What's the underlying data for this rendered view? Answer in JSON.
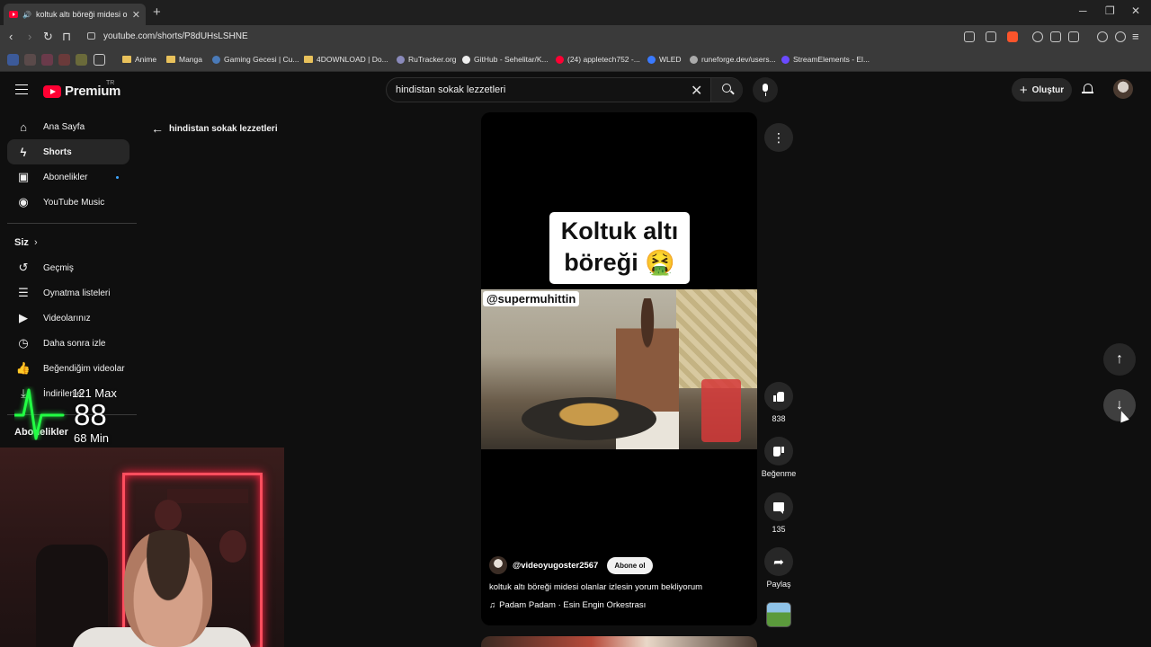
{
  "browser": {
    "tab_title": "koltuk altı böreği midesi olan",
    "url": "youtube.com/shorts/P8dUHsLSHNE",
    "bookmarks": [
      "Anime",
      "Manga",
      "Gaming Gecesi | Cu...",
      "4DOWNLOAD | Do...",
      "RuTracker.org",
      "GitHub - Sehelitar/K...",
      "(24) appletech752 -...",
      "WLED",
      "runeforge.dev/users...",
      "StreamElements - El..."
    ]
  },
  "header": {
    "logo_text": "Premium",
    "country": "TR",
    "search_query": "hindistan sokak lezzetleri",
    "create_label": "Oluştur"
  },
  "sidebar": {
    "items": [
      {
        "label": "Ana Sayfa"
      },
      {
        "label": "Shorts"
      },
      {
        "label": "Abonelikler"
      },
      {
        "label": "YouTube Music"
      }
    ],
    "you_heading": "Siz",
    "you_items": [
      {
        "label": "Geçmiş"
      },
      {
        "label": "Oynatma listeleri"
      },
      {
        "label": "Videolarınız"
      },
      {
        "label": "Daha sonra izle"
      },
      {
        "label": "Beğendiğim videolar"
      },
      {
        "label": "İndirilenler"
      }
    ],
    "subscriptions_heading": "Abonelikler"
  },
  "back": {
    "label": "hindistan sokak lezzetleri"
  },
  "short": {
    "overlay_text_line1": "Koltuk altı",
    "overlay_text_line2": "böreği 🤮",
    "watermark": "@supermuhittin",
    "channel": "@videoyugoster2567",
    "subscribe_label": "Abone ol",
    "description": "koltuk altı böreği midesi olanlar izlesin yorum bekliyorum",
    "music": "Padam Padam · Esin Engin Orkestrası"
  },
  "actions": {
    "like_count": "838",
    "dislike_label": "Beğenme",
    "comment_count": "135",
    "share_label": "Paylaş"
  },
  "heart_rate": {
    "max": "121 Max",
    "current": "88",
    "min": "68 Min",
    "color": "#22ff44"
  }
}
